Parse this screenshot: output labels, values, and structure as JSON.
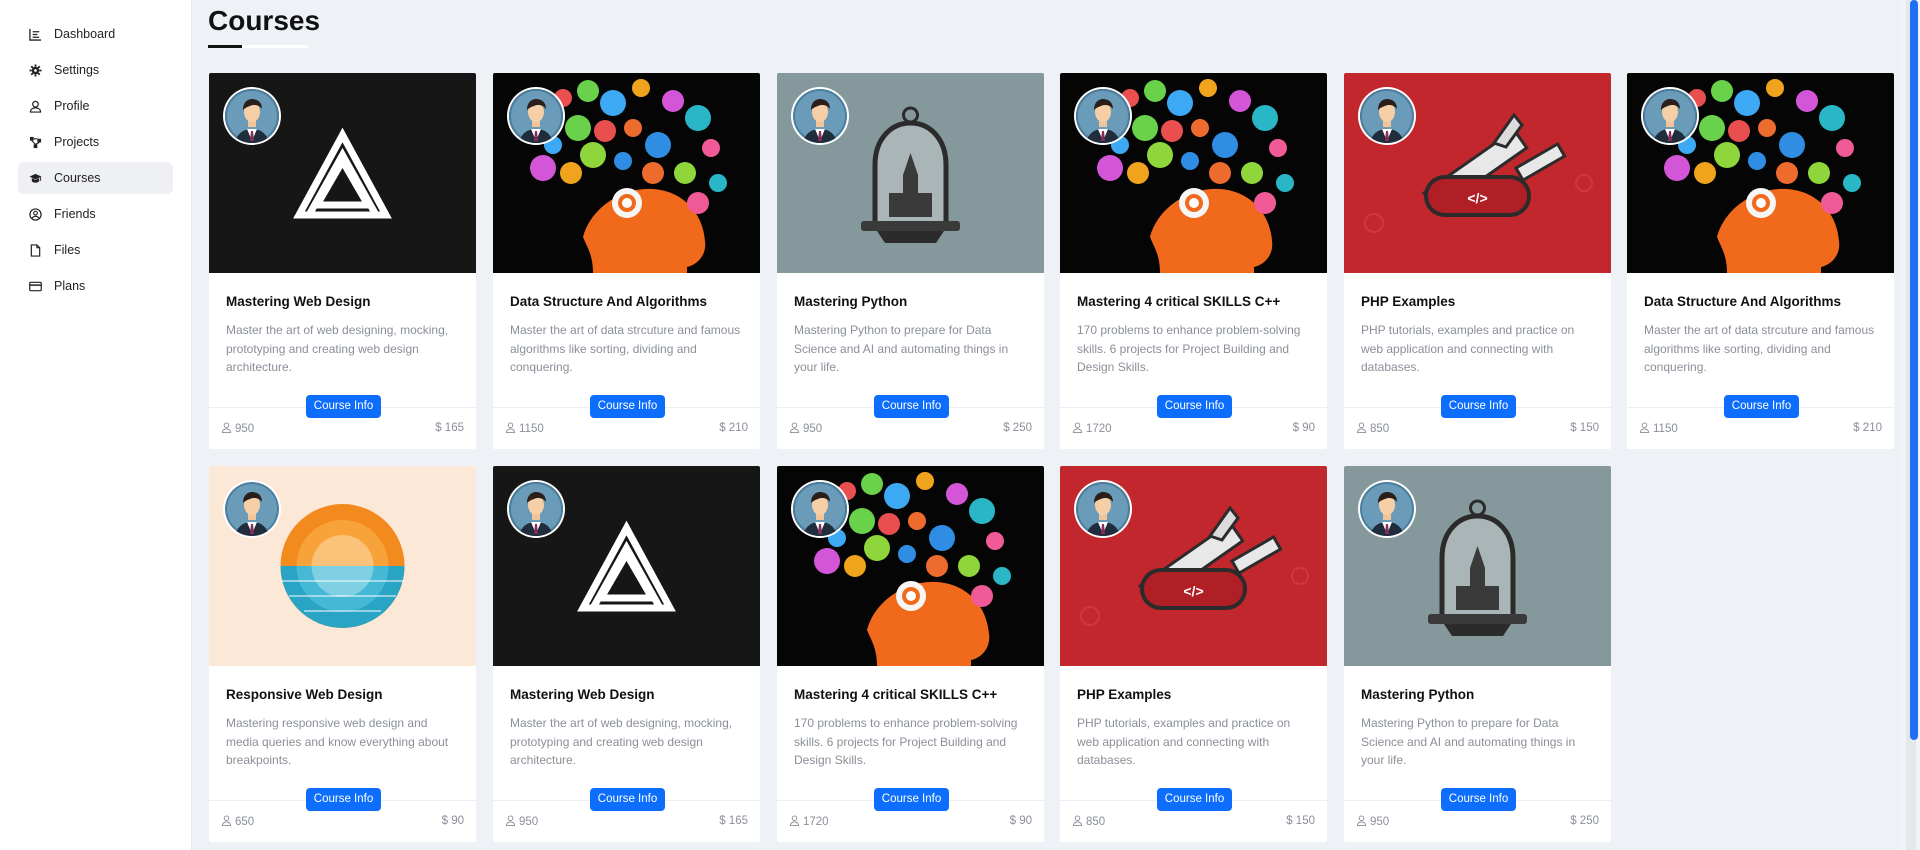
{
  "sidebar": {
    "items": [
      {
        "label": "Dashboard",
        "icon": "dashboard-icon",
        "active": false
      },
      {
        "label": "Settings",
        "icon": "gear-icon",
        "active": false
      },
      {
        "label": "Profile",
        "icon": "user-icon",
        "active": false
      },
      {
        "label": "Projects",
        "icon": "projects-icon",
        "active": false
      },
      {
        "label": "Courses",
        "icon": "graduation-cap-icon",
        "active": true
      },
      {
        "label": "Friends",
        "icon": "friends-icon",
        "active": false
      },
      {
        "label": "Files",
        "icon": "file-icon",
        "active": false
      },
      {
        "label": "Plans",
        "icon": "credit-card-icon",
        "active": false
      }
    ]
  },
  "page": {
    "title": "Courses"
  },
  "course_button_label": "Course Info",
  "courses": [
    {
      "title": "Mastering Web Design",
      "description": "Master the art of web designing, mocking, prototyping and creating web design architecture.",
      "students": "950",
      "price": "$ 165",
      "image": "web-design-logo"
    },
    {
      "title": "Data Structure And Algorithms",
      "description": "Master the art of data strcuture and famous algorithms like sorting, dividing and conquering.",
      "students": "1150",
      "price": "$ 210",
      "image": "head-science-icons"
    },
    {
      "title": "Mastering Python",
      "description": "Mastering Python to prepare for Data Science and AI and automating things in your life.",
      "students": "950",
      "price": "$ 250",
      "image": "bell-jar-building"
    },
    {
      "title": "Mastering 4 critical SKILLS C++",
      "description": "170 problems to enhance problem-solving skills. 6 projects for Project Building and Design Skills.",
      "students": "1720",
      "price": "$ 90",
      "image": "head-science-icons"
    },
    {
      "title": "PHP Examples",
      "description": "PHP tutorials, examples and practice on web application and connecting with databases.",
      "students": "850",
      "price": "$ 150",
      "image": "swiss-knife-code"
    },
    {
      "title": "Data Structure And Algorithms",
      "description": "Master the art of data strcuture and famous algorithms like sorting, dividing and conquering.",
      "students": "1150",
      "price": "$ 210",
      "image": "head-science-icons"
    },
    {
      "title": "Responsive Web Design",
      "description": "Mastering responsive web design and media queries and know everything about breakpoints.",
      "students": "650",
      "price": "$ 90",
      "image": "sunset-circle"
    },
    {
      "title": "Mastering Web Design",
      "description": "Master the art of web designing, mocking, prototyping and creating web design architecture.",
      "students": "950",
      "price": "$ 165",
      "image": "web-design-logo"
    },
    {
      "title": "Mastering 4 critical SKILLS C++",
      "description": "170 problems to enhance problem-solving skills. 6 projects for Project Building and Design Skills.",
      "students": "1720",
      "price": "$ 90",
      "image": "head-science-icons"
    },
    {
      "title": "PHP Examples",
      "description": "PHP tutorials, examples and practice on web application and connecting with databases.",
      "students": "850",
      "price": "$ 150",
      "image": "swiss-knife-code"
    },
    {
      "title": "Mastering Python",
      "description": "Mastering Python to prepare for Data Science and AI and automating things in your life.",
      "students": "950",
      "price": "$ 250",
      "image": "bell-jar-building"
    }
  ],
  "colors": {
    "accent": "#0d6efd",
    "background": "#eef1f5",
    "php_red": "#c1272d",
    "python_gray": "#85999c"
  }
}
